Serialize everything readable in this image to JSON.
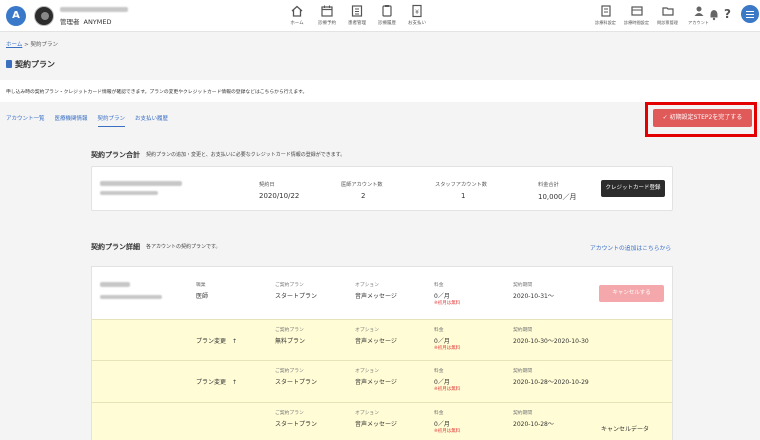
{
  "header": {
    "logo_letter": "A",
    "role": "管理者",
    "org": "ANYMED",
    "nav": [
      {
        "icon": "home-icon",
        "label": "ホーム"
      },
      {
        "icon": "calendar-icon",
        "label": "診療予約"
      },
      {
        "icon": "patient-management-icon",
        "label": "患者管理"
      },
      {
        "icon": "history-icon",
        "label": "診療履歴"
      },
      {
        "icon": "payment-icon",
        "label": "お支払い"
      }
    ],
    "right_nav": [
      {
        "icon": "settings-icon",
        "label": "診療科設定"
      },
      {
        "icon": "schedule-icon",
        "label": "診療時間設定"
      },
      {
        "icon": "folder-icon",
        "label": "問診票管理"
      },
      {
        "icon": "account-icon",
        "label": "アカウント"
      }
    ],
    "help": "?"
  },
  "breadcrumb": {
    "home": "ホーム",
    "separator": ">",
    "current": "契約プラン"
  },
  "page_title": "契約プラン",
  "notice": "申し込み時の契約プラン・クレジットカード情報が確認できます。プランの変更やクレジットカード情報の登録などはこちらから行えます。",
  "tabs": [
    {
      "label": "アカウント一覧",
      "active": false
    },
    {
      "label": "医療機関情報",
      "active": false
    },
    {
      "label": "契約プラン",
      "active": true
    },
    {
      "label": "お支払い履歴",
      "active": false
    }
  ],
  "complete_button": "初期設定STEP2を完了する",
  "summary": {
    "title": "契約プラン合計",
    "subtitle": "契約プランの追加・変更と、お支払いに必要なクレジットカード情報の登録ができます。",
    "contract_date_label": "契約日",
    "contract_date": "2020/10/22",
    "doctor_count_label": "医師アカウント数",
    "doctor_count": "2",
    "staff_count_label": "スタッフアカウント数",
    "staff_count": "1",
    "fee_label": "料金合計",
    "fee": "10,000／月",
    "credit_button": "クレジットカード登録"
  },
  "details": {
    "title": "契約プラン詳細",
    "subtitle": "各アカウントの契約プランです。",
    "add_link": "アカウントの追加はこちらから",
    "rows": [
      {
        "job_label": "職業",
        "job": "医師",
        "plan_label": "ご契約プラン",
        "plan": "スタートプラン",
        "option_label": "オプション",
        "option": "音声メッセージ",
        "fee_label": "料金",
        "fee": "0／月",
        "fee_note": "※初月は無料",
        "period_label": "契約期間",
        "period": "2020-10-31〜",
        "action": "キャンセルする"
      },
      {
        "change": "プラン変更",
        "arrow": "↑",
        "plan_label": "ご契約プラン",
        "plan": "無料プラン",
        "option_label": "オプション",
        "option": "音声メッセージ",
        "fee_label": "料金",
        "fee": "0／月",
        "fee_note": "※初月は無料",
        "period_label": "契約期間",
        "period": "2020-10-30〜2020-10-30"
      },
      {
        "change": "プラン変更",
        "arrow": "↑",
        "plan_label": "ご契約プラン",
        "plan": "スタートプラン",
        "option_label": "オプション",
        "option": "音声メッセージ",
        "fee_label": "料金",
        "fee": "0／月",
        "fee_note": "※初月は無料",
        "period_label": "契約期間",
        "period": "2020-10-28〜2020-10-29"
      },
      {
        "plan_label": "ご契約プラン",
        "plan": "スタートプラン",
        "option_label": "オプション",
        "option": "音声メッセージ",
        "fee_label": "料金",
        "fee": "0／月",
        "fee_note": "※初月は無料",
        "period_label": "契約期間",
        "period": "2020-10-28〜",
        "status": "キャンセルデータ"
      }
    ]
  },
  "colors": {
    "accent": "#3a6fc4",
    "highlight": "#e30000",
    "complete_button": "#e05a5a",
    "row_yellow": "#fffcd6"
  }
}
